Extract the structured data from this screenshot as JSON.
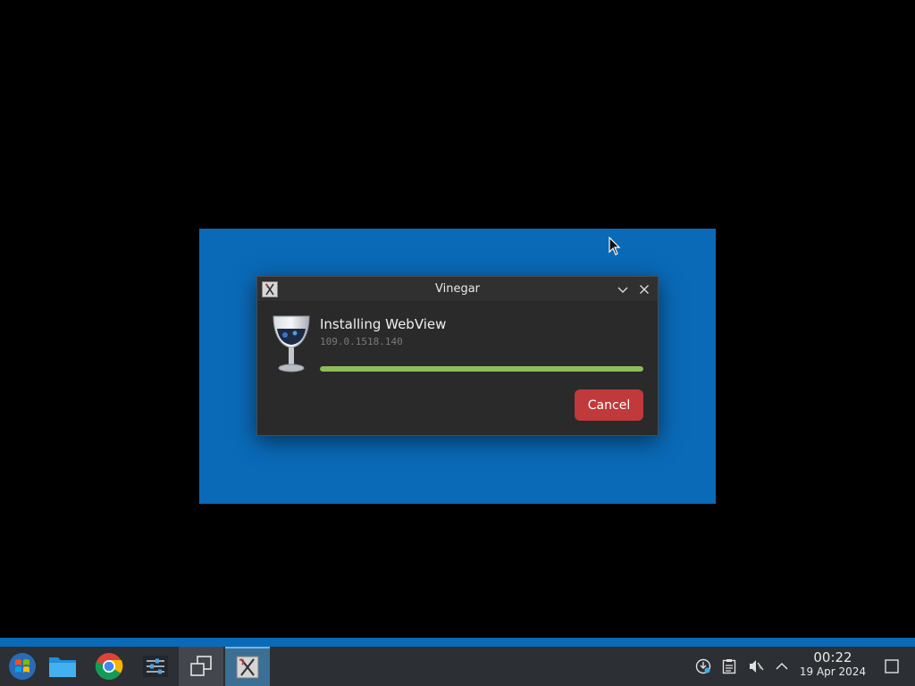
{
  "dialog": {
    "title": "Vinegar",
    "heading": "Installing WebView",
    "version": "109.0.1518.140",
    "progress_fraction": 1.0,
    "cancel_label": "Cancel",
    "accent_color": "#c0393b",
    "progress_color": "#8fbc5a"
  },
  "taskbar": {
    "items": [
      {
        "name": "start-menu",
        "icon": "windows-logo-icon"
      },
      {
        "name": "file-manager",
        "icon": "folder-icon"
      },
      {
        "name": "chrome",
        "icon": "chrome-icon"
      },
      {
        "name": "settings",
        "icon": "sliders-icon"
      },
      {
        "name": "task-view",
        "icon": "windows-overlap-icon"
      },
      {
        "name": "vinegar",
        "icon": "vinegar-icon"
      }
    ],
    "tray_icons": [
      "network-icon",
      "clipboard-icon",
      "volume-muted-icon",
      "chevron-up-icon"
    ],
    "clock_time": "00:22",
    "clock_date": "19 Apr 2024"
  },
  "colors": {
    "wallpaper": "#0a6ab8",
    "taskbar": "#2c2f33"
  }
}
